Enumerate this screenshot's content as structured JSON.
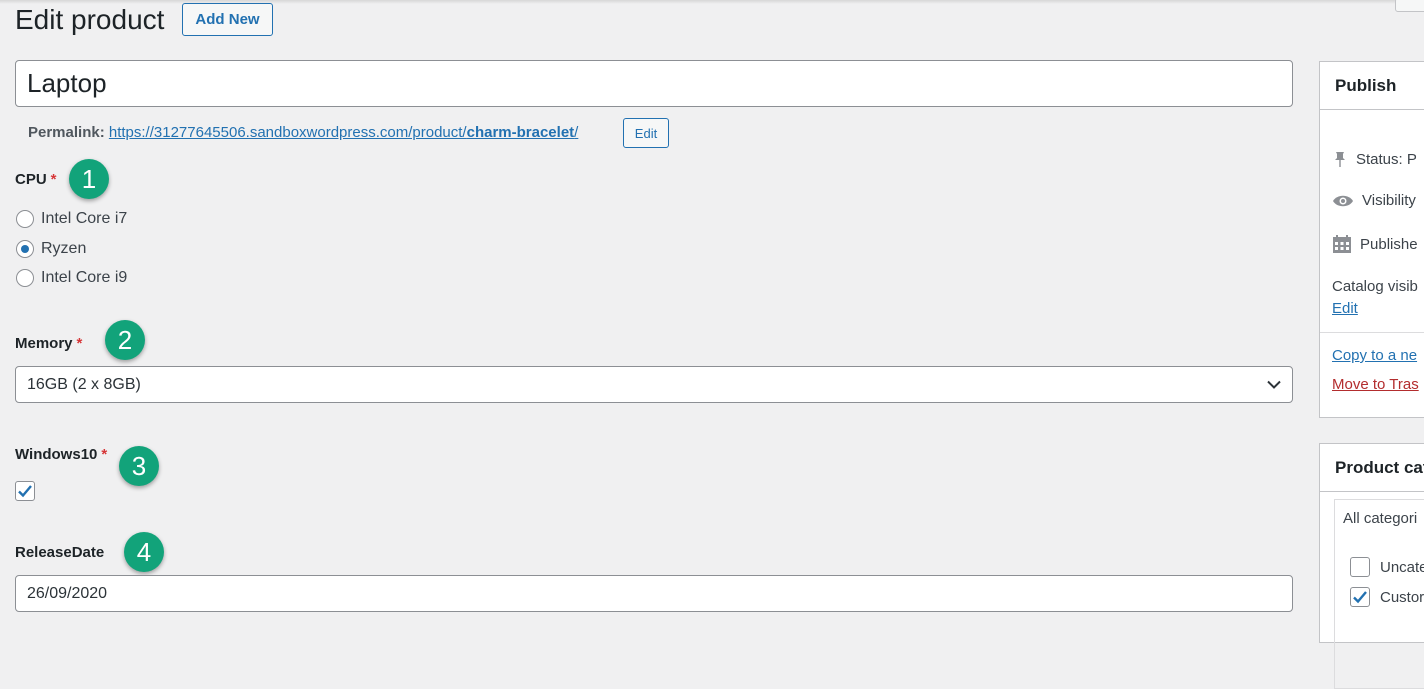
{
  "page": {
    "title": "Edit product",
    "add_new_label": "Add New"
  },
  "product": {
    "title_value": "Laptop",
    "permalink_label": "Permalink:",
    "permalink_base": "https://31277645506.sandboxwordpress.com/product/",
    "permalink_slug": "charm-bracelet",
    "permalink_trailing": "/",
    "permalink_edit_label": "Edit"
  },
  "fields": {
    "cpu": {
      "label": "CPU",
      "required_mark": "*",
      "badge": "1",
      "options": [
        "Intel Core i7",
        "Ryzen",
        "Intel Core i9"
      ],
      "selected": "Ryzen"
    },
    "memory": {
      "label": "Memory",
      "required_mark": "*",
      "badge": "2",
      "selected_value": "16GB (2 x 8GB)"
    },
    "windows10": {
      "label": "Windows10",
      "required_mark": "*",
      "badge": "3",
      "checked": true
    },
    "release_date": {
      "label": "ReleaseDate",
      "badge": "4",
      "value": "26/09/2020"
    }
  },
  "publish_panel": {
    "title": "Publish",
    "status_label": "Status: P",
    "visibility_label": "Visibility",
    "published_label": "Publishe",
    "catalog_visibility_label": "Catalog visib",
    "catalog_edit_link": "Edit",
    "copy_link": "Copy to a ne",
    "trash_link": "Move to Tras"
  },
  "categories_panel": {
    "title": "Product cat",
    "tab_all": "All categori",
    "items": [
      {
        "label": "Uncate",
        "checked": false
      },
      {
        "label": "Custor",
        "checked": true
      }
    ]
  },
  "colors": {
    "accent": "#2271b1",
    "required": "#d63638",
    "badge": "#12a37a",
    "trash": "#b32d2e"
  }
}
